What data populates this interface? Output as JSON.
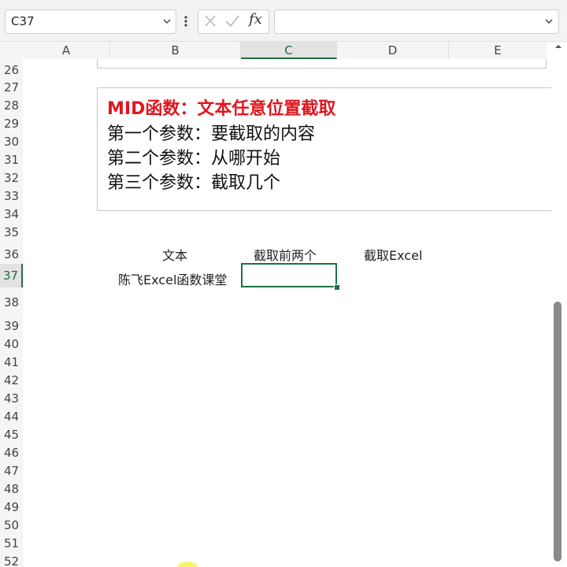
{
  "formula_bar": {
    "name_box_value": "C37",
    "name_box_dropdown_icon": "chevron-down-icon",
    "more_icon": "vertical-dots-icon",
    "cancel_icon": "close-icon",
    "enter_icon": "check-icon",
    "fx_label": "fx",
    "formula_value": "",
    "formula_dropdown_icon": "chevron-down-icon"
  },
  "columns": [
    {
      "label": "A",
      "selected": false
    },
    {
      "label": "B",
      "selected": false
    },
    {
      "label": "C",
      "selected": true
    },
    {
      "label": "D",
      "selected": false
    },
    {
      "label": "E",
      "selected": false
    }
  ],
  "rows": [
    {
      "label": "26"
    },
    {
      "label": "27"
    },
    {
      "label": "28"
    },
    {
      "label": "29"
    },
    {
      "label": "30"
    },
    {
      "label": "31"
    },
    {
      "label": "32"
    },
    {
      "label": "33"
    },
    {
      "label": "34"
    },
    {
      "label": "35"
    },
    {
      "label": "36"
    },
    {
      "label": "37",
      "selected": true
    },
    {
      "label": "38"
    },
    {
      "label": "39"
    },
    {
      "label": "40"
    },
    {
      "label": "41"
    },
    {
      "label": "42"
    },
    {
      "label": "43"
    },
    {
      "label": "44"
    },
    {
      "label": "45"
    },
    {
      "label": "46"
    },
    {
      "label": "47"
    },
    {
      "label": "48"
    },
    {
      "label": "49"
    },
    {
      "label": "50"
    },
    {
      "label": "51"
    },
    {
      "label": "52"
    }
  ],
  "textbox": {
    "title": "MID函数：文本任意位置截取",
    "lines": [
      "第一个参数：要截取的内容",
      "第二个参数：从哪开始",
      "第三个参数：截取几个"
    ],
    "title_color": "#e0161e"
  },
  "cells": {
    "b36": "文本",
    "c36": "截取前两个",
    "d36": "截取Excel",
    "b37": "陈飞Excel函数课堂",
    "c37": ""
  },
  "accent_color": "#1e7145"
}
